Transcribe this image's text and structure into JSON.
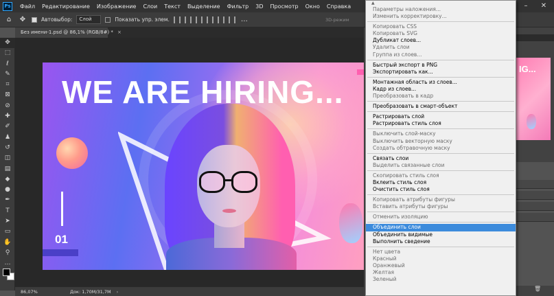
{
  "menubar": {
    "logo": "Ps",
    "items": [
      "Файл",
      "Редактирование",
      "Изображение",
      "Слои",
      "Текст",
      "Выделение",
      "Фильтр",
      "3D",
      "Просмотр",
      "Окно",
      "Справка"
    ]
  },
  "options": {
    "autoselect_label": "Автовыбор:",
    "autoselect_value": "Слой",
    "transform_label": "Показать упр. элем.",
    "mode_3d": "3D-режим"
  },
  "document": {
    "tab_title": "Без имени-1.psd @ 86,1% (RGB/8#) *",
    "close": "×"
  },
  "artwork": {
    "headline": "WE ARE HIRING...",
    "number": "01"
  },
  "status": {
    "zoom": "86,07%",
    "doc_size": "Док: 1,70M/31,7M"
  },
  "panel": {
    "thumb_text": "IG..."
  },
  "context_menu": {
    "scroll_up": "▲",
    "items": [
      {
        "label": "Параметры наложения...",
        "disabled": true
      },
      {
        "label": "Изменить корректировку...",
        "disabled": true
      },
      {
        "sep": true
      },
      {
        "label": "Копировать CSS",
        "disabled": true
      },
      {
        "label": "Копировать SVG",
        "disabled": true
      },
      {
        "label": "Дубликат слоев...",
        "disabled": false
      },
      {
        "label": "Удалить слои",
        "disabled": true
      },
      {
        "label": "Группа из слоев...",
        "disabled": true
      },
      {
        "sep": true
      },
      {
        "label": "Быстрый экспорт в PNG",
        "disabled": false
      },
      {
        "label": "Экспортировать как...",
        "disabled": false
      },
      {
        "sep": true
      },
      {
        "label": "Монтажная область из слоев...",
        "disabled": false
      },
      {
        "label": "Кадр из слоев...",
        "disabled": false
      },
      {
        "label": "Преобразовать в кадр",
        "disabled": true
      },
      {
        "sep": true
      },
      {
        "label": "Преобразовать в смарт-объект",
        "disabled": false
      },
      {
        "sep": true
      },
      {
        "label": "Растрировать слой",
        "disabled": false
      },
      {
        "label": "Растрировать стиль слоя",
        "disabled": false
      },
      {
        "sep": true
      },
      {
        "label": "Выключить слой-маску",
        "disabled": true
      },
      {
        "label": "Выключить векторную маску",
        "disabled": true
      },
      {
        "label": "Создать обтравочную маску",
        "disabled": true
      },
      {
        "sep": true
      },
      {
        "label": "Связать слои",
        "disabled": false
      },
      {
        "label": "Выделить связанные слои",
        "disabled": true
      },
      {
        "sep": true
      },
      {
        "label": "Скопировать стиль слоя",
        "disabled": true
      },
      {
        "label": "Вклеить стиль слоя",
        "disabled": false
      },
      {
        "label": "Очистить стиль слоя",
        "disabled": false
      },
      {
        "sep": true
      },
      {
        "label": "Копировать атрибуты фигуры",
        "disabled": true
      },
      {
        "label": "Вставить атрибуты фигуры",
        "disabled": true
      },
      {
        "sep": true
      },
      {
        "label": "Отменить изоляцию",
        "disabled": true
      },
      {
        "sep": true
      },
      {
        "label": "Объединить слои",
        "disabled": false,
        "highlight": true
      },
      {
        "label": "Объединить видимые",
        "disabled": false
      },
      {
        "label": "Выполнить сведение",
        "disabled": false
      },
      {
        "sep": true
      },
      {
        "label": "Нет цвета",
        "disabled": true
      },
      {
        "label": "Красный",
        "disabled": true
      },
      {
        "label": "Оранжевый",
        "disabled": true
      },
      {
        "label": "Желтая",
        "disabled": true
      },
      {
        "label": "Зеленый",
        "disabled": true
      }
    ]
  }
}
